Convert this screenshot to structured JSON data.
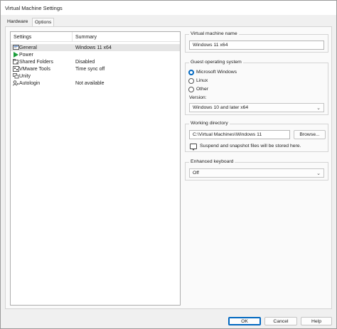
{
  "window": {
    "title": "Virtual Machine Settings"
  },
  "tabs": [
    {
      "label": "Hardware"
    },
    {
      "label": "Options"
    }
  ],
  "list": {
    "headers": {
      "settings": "Settings",
      "summary": "Summary"
    },
    "rows": [
      {
        "name": "General",
        "summary": "Windows 11 x64",
        "icon": "general-icon"
      },
      {
        "name": "Power",
        "summary": "",
        "icon": "power-play-icon"
      },
      {
        "name": "Shared Folders",
        "summary": "Disabled",
        "icon": "shared-folders-icon"
      },
      {
        "name": "VMware Tools",
        "summary": "Time sync off",
        "icon": "vmware-tools-icon"
      },
      {
        "name": "Unity",
        "summary": "",
        "icon": "unity-icon"
      },
      {
        "name": "Autologin",
        "summary": "Not available",
        "icon": "autologin-icon"
      }
    ]
  },
  "vm_name": {
    "legend": "Virtual machine name",
    "value": "Windows 11 x64"
  },
  "guest_os": {
    "legend": "Guest operating system",
    "options": [
      "Microsoft Windows",
      "Linux",
      "Other"
    ],
    "selected": "Microsoft Windows",
    "version_label": "Version:",
    "version_value": "Windows 10 and later x64"
  },
  "working_dir": {
    "legend": "Working directory",
    "value": "C:\\Virtual Machines\\Windows 11",
    "browse_label": "Browse...",
    "note": "Suspend and snapshot files will be stored here."
  },
  "keyboard": {
    "legend": "Enhanced keyboard",
    "value": "Off"
  },
  "footer": {
    "ok": "OK",
    "cancel": "Cancel",
    "help": "Help"
  },
  "colors": {
    "accent": "#0067c0",
    "play_green": "#1a9e3a"
  }
}
